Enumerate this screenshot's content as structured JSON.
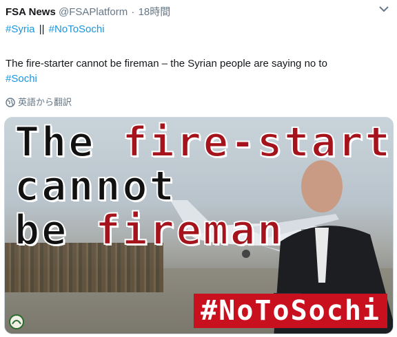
{
  "tweet": {
    "author_name": "FSA News",
    "handle": "@FSAPlatform",
    "separator": "·",
    "timestamp": "18時間",
    "hashtags": [
      "#Syria",
      "#NoToSochi"
    ],
    "hashtag_separator": "||",
    "body_text": "The fire-starter cannot be fireman – the Syrian people are saying no to",
    "body_hashtag": "#Sochi",
    "translate_label": "英語から翻訳"
  },
  "media": {
    "headline_line1_a": "The",
    "headline_line1_b": "fire-starter",
    "headline_line2": "cannot",
    "headline_line3_a": "be",
    "headline_line3_b": "fireman",
    "badge_text": "#NoToSochi"
  },
  "colors": {
    "link": "#1b95e0",
    "headline_red": "#a5141c",
    "badge_red": "#c8101e",
    "muted": "#657786"
  },
  "icons": {
    "menu": "chevron-down-icon",
    "translate": "globe-icon"
  }
}
